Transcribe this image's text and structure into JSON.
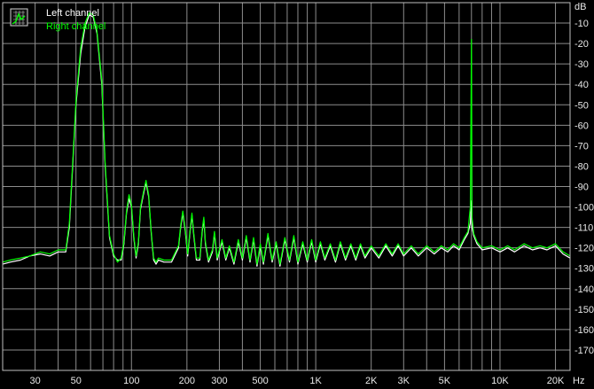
{
  "chart_data": {
    "type": "line",
    "title": "",
    "xlabel": "",
    "ylabel": "",
    "x_unit_label": "Hz",
    "y_unit_label": "dB",
    "x_scale": "log",
    "xlim": [
      20,
      24000
    ],
    "ylim": [
      -180,
      0
    ],
    "grid": true,
    "legend_placement": "top-left",
    "background_color": "#000000",
    "grid_color": "#8c8c8c",
    "x_ticks": [
      {
        "value": 30,
        "label": "30"
      },
      {
        "value": 50,
        "label": "50"
      },
      {
        "value": 100,
        "label": "100"
      },
      {
        "value": 200,
        "label": "200"
      },
      {
        "value": 300,
        "label": "300"
      },
      {
        "value": 500,
        "label": "500"
      },
      {
        "value": 1000,
        "label": "1K"
      },
      {
        "value": 2000,
        "label": "2K"
      },
      {
        "value": 3000,
        "label": "3K"
      },
      {
        "value": 5000,
        "label": "5K"
      },
      {
        "value": 10000,
        "label": "10K"
      },
      {
        "value": 20000,
        "label": "20K"
      }
    ],
    "x_gridlines": [
      20,
      30,
      40,
      50,
      60,
      70,
      80,
      90,
      100,
      200,
      300,
      400,
      500,
      600,
      700,
      800,
      900,
      1000,
      2000,
      3000,
      4000,
      5000,
      6000,
      7000,
      8000,
      9000,
      10000,
      20000
    ],
    "y_ticks": [
      -10,
      -20,
      -30,
      -40,
      -50,
      -60,
      -70,
      -80,
      -90,
      -100,
      -110,
      -120,
      -130,
      -140,
      -150,
      -160,
      -170
    ],
    "series": [
      {
        "name": "Left channel",
        "color": "#ffffff",
        "points": [
          [
            20,
            -128
          ],
          [
            22,
            -127
          ],
          [
            25,
            -126
          ],
          [
            28,
            -124
          ],
          [
            32,
            -123
          ],
          [
            36,
            -124
          ],
          [
            40,
            -122
          ],
          [
            44,
            -122
          ],
          [
            46,
            -110
          ],
          [
            48,
            -80
          ],
          [
            50,
            -50
          ],
          [
            53,
            -25
          ],
          [
            56,
            -12
          ],
          [
            59,
            -6
          ],
          [
            62,
            -7
          ],
          [
            65,
            -15
          ],
          [
            69,
            -40
          ],
          [
            72,
            -80
          ],
          [
            76,
            -115
          ],
          [
            80,
            -124
          ],
          [
            84,
            -126
          ],
          [
            88,
            -126
          ],
          [
            91,
            -118
          ],
          [
            94,
            -103
          ],
          [
            97,
            -96
          ],
          [
            100,
            -100
          ],
          [
            103,
            -115
          ],
          [
            106,
            -125
          ],
          [
            109,
            -118
          ],
          [
            112,
            -101
          ],
          [
            116,
            -94
          ],
          [
            120,
            -88
          ],
          [
            124,
            -95
          ],
          [
            128,
            -113
          ],
          [
            132,
            -126
          ],
          [
            136,
            -128
          ],
          [
            140,
            -126
          ],
          [
            150,
            -127
          ],
          [
            165,
            -127
          ],
          [
            180,
            -120
          ],
          [
            185,
            -110
          ],
          [
            190,
            -103
          ],
          [
            196,
            -112
          ],
          [
            202,
            -124
          ],
          [
            208,
            -112
          ],
          [
            213,
            -104
          ],
          [
            218,
            -114
          ],
          [
            225,
            -126
          ],
          [
            235,
            -126
          ],
          [
            242,
            -112
          ],
          [
            247,
            -106
          ],
          [
            252,
            -118
          ],
          [
            262,
            -127
          ],
          [
            275,
            -122
          ],
          [
            282,
            -113
          ],
          [
            292,
            -126
          ],
          [
            310,
            -117
          ],
          [
            325,
            -126
          ],
          [
            340,
            -120
          ],
          [
            360,
            -128
          ],
          [
            380,
            -117
          ],
          [
            400,
            -126
          ],
          [
            420,
            -115
          ],
          [
            440,
            -127
          ],
          [
            460,
            -116
          ],
          [
            480,
            -129
          ],
          [
            500,
            -119
          ],
          [
            520,
            -128
          ],
          [
            550,
            -114
          ],
          [
            580,
            -127
          ],
          [
            610,
            -118
          ],
          [
            640,
            -129
          ],
          [
            680,
            -116
          ],
          [
            720,
            -127
          ],
          [
            760,
            -115
          ],
          [
            800,
            -128
          ],
          [
            850,
            -118
          ],
          [
            900,
            -127
          ],
          [
            950,
            -117
          ],
          [
            1000,
            -127
          ],
          [
            1060,
            -118
          ],
          [
            1120,
            -126
          ],
          [
            1200,
            -119
          ],
          [
            1280,
            -127
          ],
          [
            1360,
            -118
          ],
          [
            1450,
            -126
          ],
          [
            1550,
            -119
          ],
          [
            1650,
            -126
          ],
          [
            1750,
            -119
          ],
          [
            1850,
            -125
          ],
          [
            2000,
            -120
          ],
          [
            2200,
            -125
          ],
          [
            2400,
            -119
          ],
          [
            2600,
            -124
          ],
          [
            2800,
            -119
          ],
          [
            3000,
            -124
          ],
          [
            3300,
            -120
          ],
          [
            3600,
            -124
          ],
          [
            4000,
            -120
          ],
          [
            4400,
            -123
          ],
          [
            4800,
            -120
          ],
          [
            5200,
            -122
          ],
          [
            5600,
            -119
          ],
          [
            6000,
            -121
          ],
          [
            6400,
            -116
          ],
          [
            6700,
            -113
          ],
          [
            6900,
            -108
          ],
          [
            7000,
            -97
          ],
          [
            7050,
            -110
          ],
          [
            7200,
            -114
          ],
          [
            7500,
            -118
          ],
          [
            8000,
            -121
          ],
          [
            9000,
            -120
          ],
          [
            10000,
            -122
          ],
          [
            11000,
            -120
          ],
          [
            12000,
            -122
          ],
          [
            13500,
            -119
          ],
          [
            15000,
            -121
          ],
          [
            16500,
            -120
          ],
          [
            18000,
            -121
          ],
          [
            20000,
            -119
          ],
          [
            22000,
            -123
          ],
          [
            24000,
            -125
          ]
        ]
      },
      {
        "name": "Right channel",
        "color": "#00ff00",
        "points": [
          [
            20,
            -127
          ],
          [
            22,
            -126
          ],
          [
            25,
            -125
          ],
          [
            28,
            -124
          ],
          [
            32,
            -122
          ],
          [
            36,
            -123
          ],
          [
            40,
            -121
          ],
          [
            44,
            -121
          ],
          [
            46,
            -108
          ],
          [
            48,
            -78
          ],
          [
            50,
            -48
          ],
          [
            53,
            -22
          ],
          [
            56,
            -10
          ],
          [
            59,
            -5
          ],
          [
            62,
            -6
          ],
          [
            65,
            -14
          ],
          [
            69,
            -38
          ],
          [
            72,
            -78
          ],
          [
            76,
            -114
          ],
          [
            80,
            -123
          ],
          [
            84,
            -127
          ],
          [
            88,
            -125
          ],
          [
            91,
            -117
          ],
          [
            94,
            -102
          ],
          [
            97,
            -94
          ],
          [
            100,
            -99
          ],
          [
            103,
            -114
          ],
          [
            106,
            -124
          ],
          [
            109,
            -117
          ],
          [
            112,
            -100
          ],
          [
            116,
            -93
          ],
          [
            120,
            -87
          ],
          [
            124,
            -94
          ],
          [
            128,
            -112
          ],
          [
            132,
            -125
          ],
          [
            136,
            -127
          ],
          [
            140,
            -125
          ],
          [
            150,
            -126
          ],
          [
            165,
            -126
          ],
          [
            180,
            -119
          ],
          [
            185,
            -109
          ],
          [
            190,
            -102
          ],
          [
            196,
            -111
          ],
          [
            202,
            -123
          ],
          [
            208,
            -111
          ],
          [
            213,
            -103
          ],
          [
            218,
            -113
          ],
          [
            225,
            -125
          ],
          [
            235,
            -125
          ],
          [
            242,
            -111
          ],
          [
            247,
            -105
          ],
          [
            252,
            -117
          ],
          [
            262,
            -126
          ],
          [
            275,
            -121
          ],
          [
            282,
            -112
          ],
          [
            292,
            -125
          ],
          [
            310,
            -116
          ],
          [
            325,
            -125
          ],
          [
            340,
            -119
          ],
          [
            360,
            -127
          ],
          [
            380,
            -116
          ],
          [
            400,
            -125
          ],
          [
            420,
            -114
          ],
          [
            440,
            -126
          ],
          [
            460,
            -115
          ],
          [
            480,
            -128
          ],
          [
            500,
            -118
          ],
          [
            520,
            -127
          ],
          [
            550,
            -113
          ],
          [
            580,
            -126
          ],
          [
            610,
            -117
          ],
          [
            640,
            -128
          ],
          [
            680,
            -115
          ],
          [
            720,
            -126
          ],
          [
            760,
            -114
          ],
          [
            800,
            -127
          ],
          [
            850,
            -117
          ],
          [
            900,
            -126
          ],
          [
            950,
            -116
          ],
          [
            1000,
            -126
          ],
          [
            1060,
            -117
          ],
          [
            1120,
            -125
          ],
          [
            1200,
            -118
          ],
          [
            1280,
            -126
          ],
          [
            1360,
            -117
          ],
          [
            1450,
            -125
          ],
          [
            1550,
            -118
          ],
          [
            1650,
            -125
          ],
          [
            1750,
            -118
          ],
          [
            1850,
            -124
          ],
          [
            2000,
            -119
          ],
          [
            2200,
            -124
          ],
          [
            2400,
            -118
          ],
          [
            2600,
            -123
          ],
          [
            2800,
            -118
          ],
          [
            3000,
            -123
          ],
          [
            3300,
            -119
          ],
          [
            3600,
            -123
          ],
          [
            4000,
            -119
          ],
          [
            4400,
            -122
          ],
          [
            4800,
            -119
          ],
          [
            5200,
            -121
          ],
          [
            5600,
            -118
          ],
          [
            6000,
            -120
          ],
          [
            6400,
            -115
          ],
          [
            6700,
            -112
          ],
          [
            6900,
            -100
          ],
          [
            7000,
            -18
          ],
          [
            7050,
            -105
          ],
          [
            7200,
            -113
          ],
          [
            7500,
            -117
          ],
          [
            8000,
            -120
          ],
          [
            9000,
            -119
          ],
          [
            10000,
            -121
          ],
          [
            11000,
            -119
          ],
          [
            12000,
            -121
          ],
          [
            13500,
            -118
          ],
          [
            15000,
            -120
          ],
          [
            16500,
            -119
          ],
          [
            18000,
            -120
          ],
          [
            20000,
            -118
          ],
          [
            22000,
            -122
          ],
          [
            24000,
            -124
          ]
        ]
      }
    ]
  }
}
